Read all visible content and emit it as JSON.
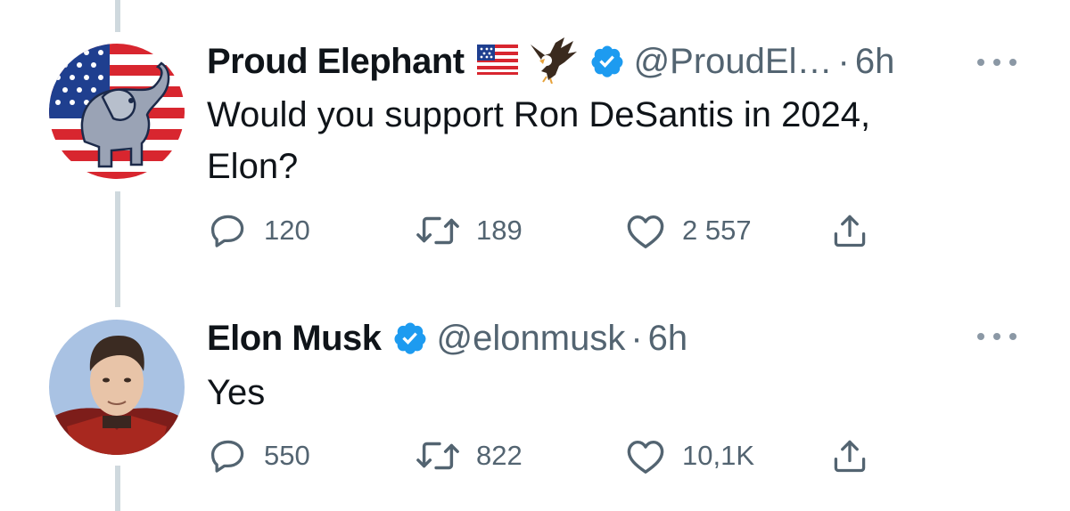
{
  "tweets": [
    {
      "author": "Proud Elephant",
      "emoji_flag": "us-flag-icon",
      "emoji_eagle": "eagle-icon",
      "handle": "@ProudEl…",
      "separator": "·",
      "time": "6h",
      "text_line1": "Would you support Ron DeSantis in 2024,",
      "text_line2": "Elon?",
      "replies": "120",
      "retweets": "189",
      "likes": "2 557"
    },
    {
      "author": "Elon Musk",
      "handle": "@elonmusk",
      "separator": "·",
      "time": "6h",
      "text_line1": "Yes",
      "replies": "550",
      "retweets": "822",
      "likes": "10,1K"
    }
  ],
  "colors": {
    "text": "#0f1419",
    "secondary": "#536471",
    "verified": "#1d9bf0",
    "thread_line": "#cfd9de"
  }
}
